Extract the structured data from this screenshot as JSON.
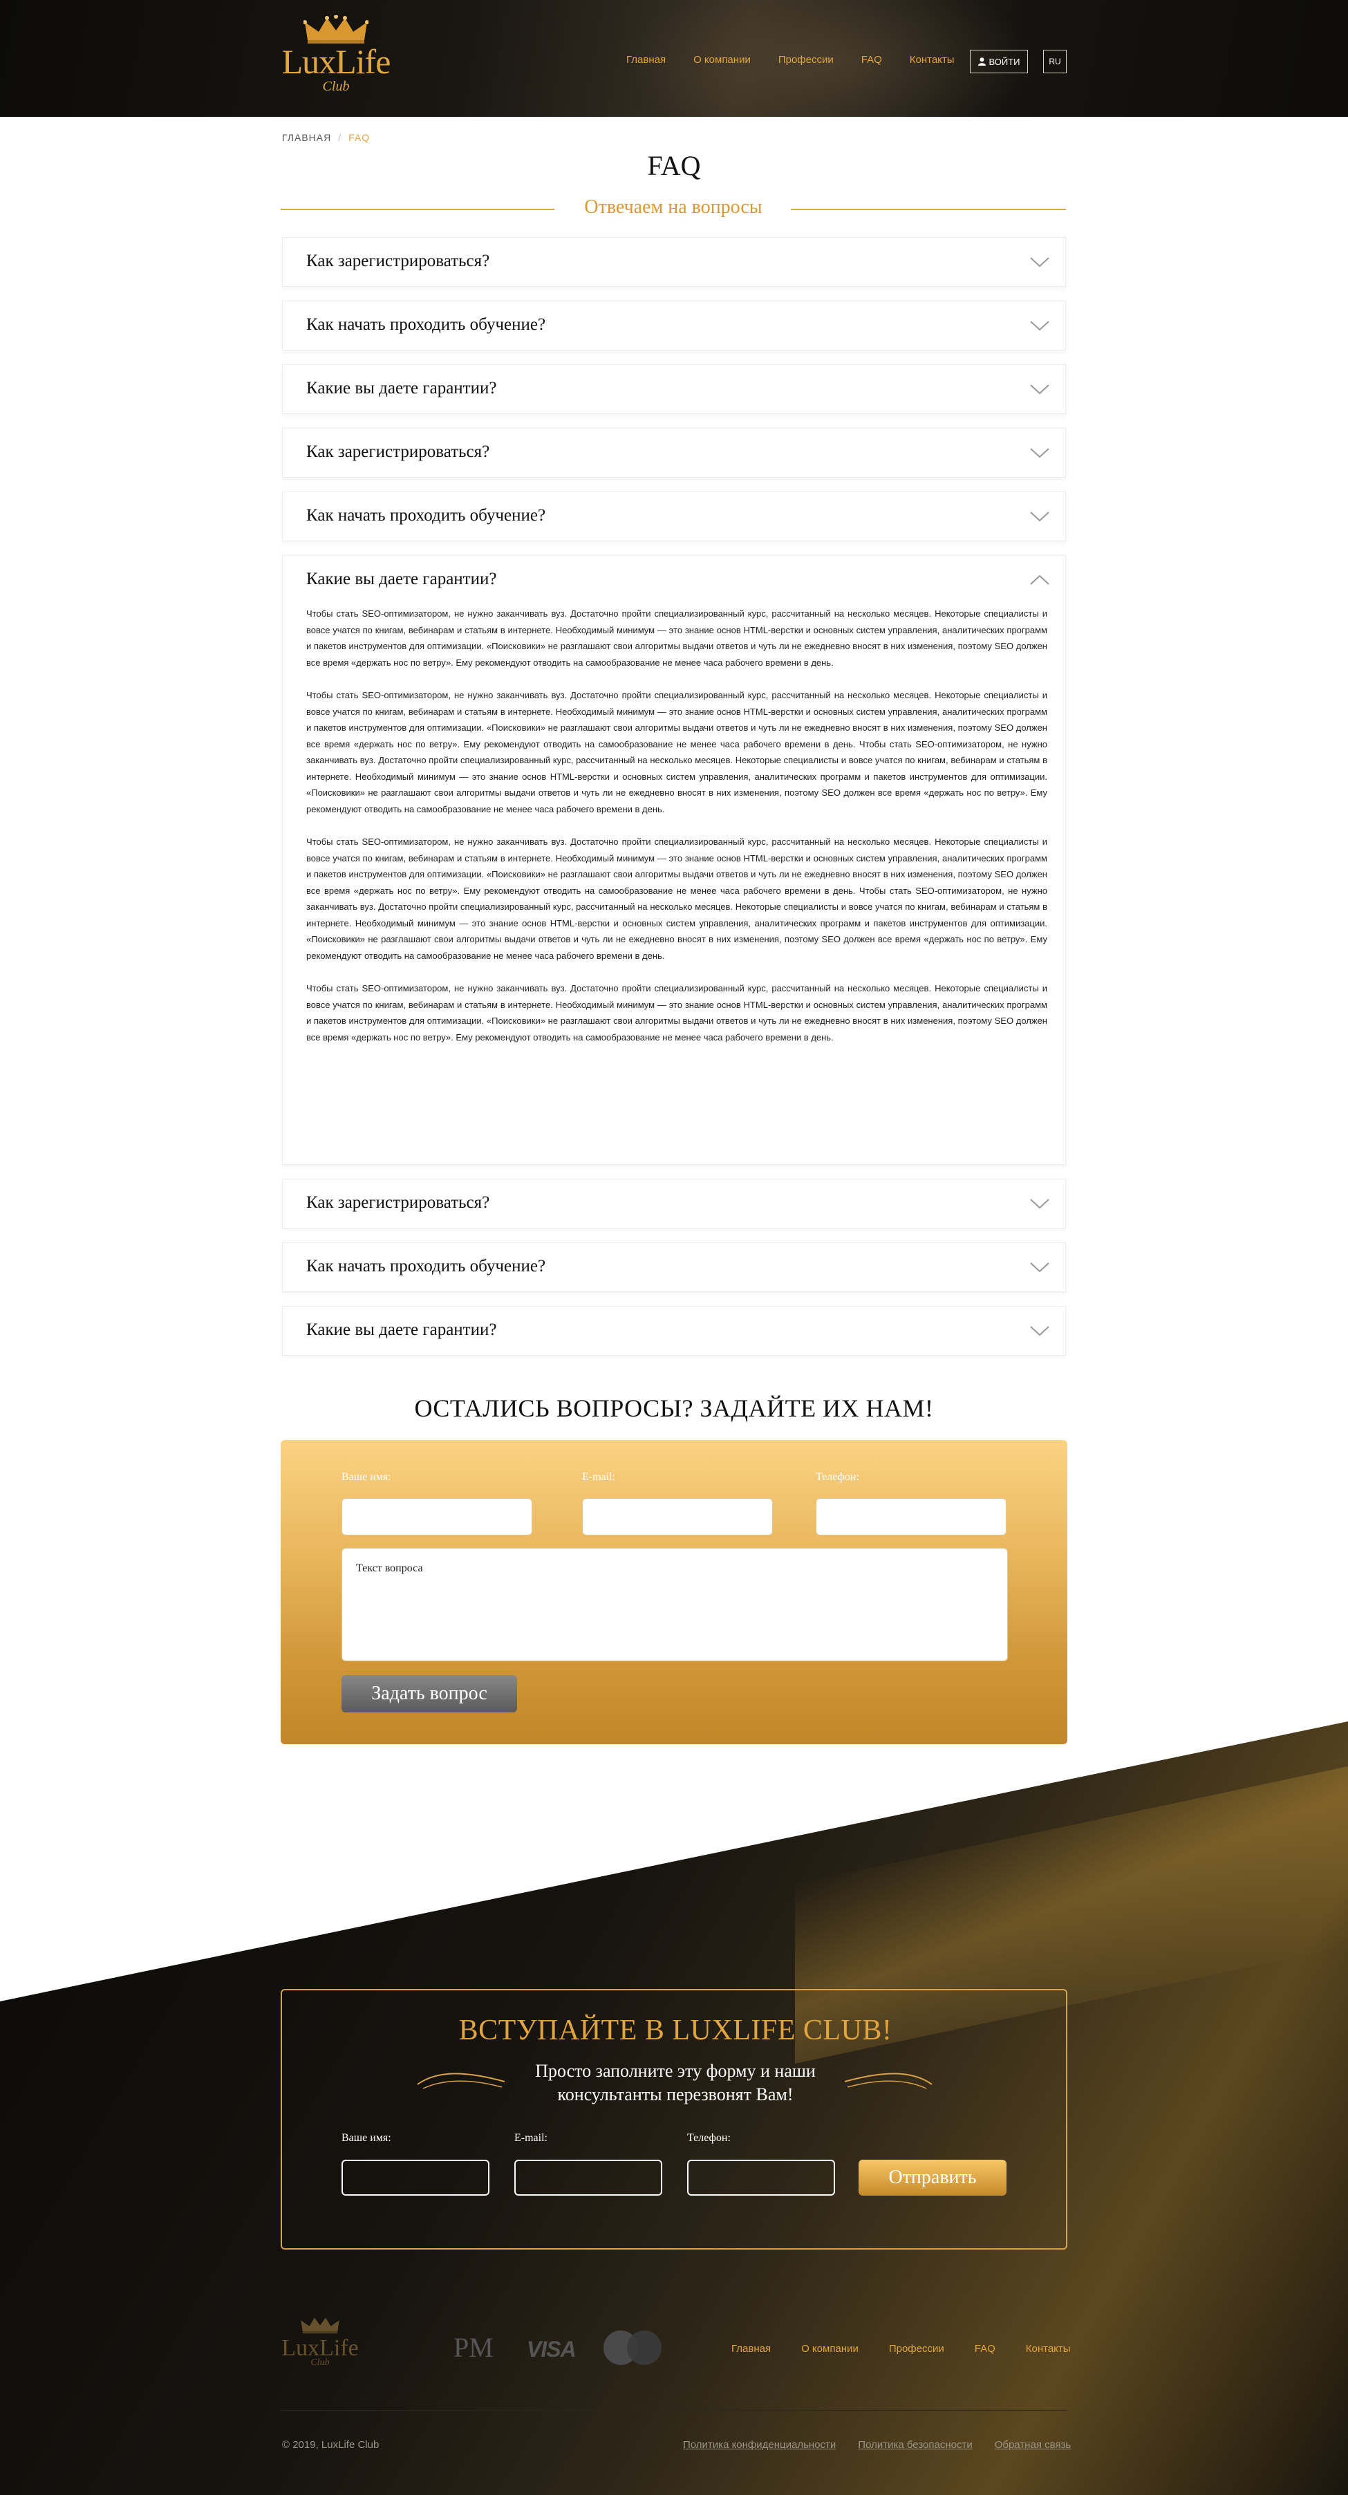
{
  "header": {
    "logo_text": "LuxLife",
    "logo_sub": "Club",
    "nav": [
      "Главная",
      "О компании",
      "Профессии",
      "FAQ",
      "Контакты"
    ],
    "login_label": "ВОЙТИ",
    "lang_label": "RU"
  },
  "breadcrumb": {
    "home": "ГЛАВНАЯ",
    "separator": "/",
    "current": "FAQ"
  },
  "page_title": "FAQ",
  "subtitle": "Отвечаем на вопросы",
  "faq": [
    {
      "question": "Как зарегистрироваться?"
    },
    {
      "question": "Как начать проходить обучение?"
    },
    {
      "question": "Какие вы даете гарантии?"
    },
    {
      "question": "Как зарегистрироваться?"
    },
    {
      "question": "Как начать проходить обучение?"
    },
    {
      "question": "Какие вы даете гарантии?",
      "open": true,
      "paragraphs": [
        "Чтобы стать SEO-оптимизатором, не нужно заканчивать вуз. Достаточно пройти специализированный курс, рассчитанный на несколько месяцев. Некоторые специалисты и вовсе учатся по книгам, вебинарам и статьям в интернете. Необходимый минимум — это знание основ HTML-верстки и основных систем управления, аналитических программ и пакетов инструментов для оптимизации. «Поисковики» не разглашают свои алгоритмы выдачи ответов и чуть ли не ежедневно вносят в них изменения, поэтому SEO должен все время «держать нос по ветру». Ему рекомендуют отводить на самообразование не менее часа рабочего времени в день.",
        "Чтобы стать SEO-оптимизатором, не нужно заканчивать вуз. Достаточно пройти специализированный курс, рассчитанный на несколько месяцев. Некоторые специалисты и вовсе учатся по книгам, вебинарам и статьям в интернете. Необходимый минимум — это знание основ HTML-верстки и основных систем управления, аналитических программ и пакетов инструментов для оптимизации. «Поисковики» не разглашают свои алгоритмы выдачи ответов и чуть ли не ежедневно вносят в них изменения, поэтому SEO должен все время «держать нос по ветру». Ему рекомендуют отводить на самообразование не менее часа рабочего времени в день. Чтобы стать SEO-оптимизатором, не нужно заканчивать вуз. Достаточно пройти специализированный курс, рассчитанный на несколько месяцев. Некоторые специалисты и вовсе учатся по книгам, вебинарам и статьям в интернете. Необходимый минимум — это знание основ HTML-верстки и основных систем управления, аналитических программ и пакетов инструментов для оптимизации. «Поисковики» не разглашают свои алгоритмы выдачи ответов и чуть ли не ежедневно вносят в них изменения, поэтому SEO должен все время «держать нос по ветру». Ему рекомендуют отводить на самообразование не менее часа рабочего времени в день.",
        "Чтобы стать SEO-оптимизатором, не нужно заканчивать вуз. Достаточно пройти специализированный курс, рассчитанный на несколько месяцев. Некоторые специалисты и вовсе учатся по книгам, вебинарам и статьям в интернете. Необходимый минимум — это знание основ HTML-верстки и основных систем управления, аналитических программ и пакетов инструментов для оптимизации. «Поисковики» не разглашают свои алгоритмы выдачи ответов и чуть ли не ежедневно вносят в них изменения, поэтому SEO должен все время «держать нос по ветру». Ему рекомендуют отводить на самообразование не менее часа рабочего времени в день. Чтобы стать SEO-оптимизатором, не нужно заканчивать вуз. Достаточно пройти специализированный курс, рассчитанный на несколько месяцев. Некоторые специалисты и вовсе учатся по книгам, вебинарам и статьям в интернете. Необходимый минимум — это знание основ HTML-верстки и основных систем управления, аналитических программ и пакетов инструментов для оптимизации. «Поисковики» не разглашают свои алгоритмы выдачи ответов и чуть ли не ежедневно вносят в них изменения, поэтому SEO должен все время «держать нос по ветру». Ему рекомендуют отводить на самообразование не менее часа рабочего времени в день.",
        "Чтобы стать SEO-оптимизатором, не нужно заканчивать вуз. Достаточно пройти специализированный курс, рассчитанный на несколько месяцев. Некоторые специалисты и вовсе учатся по книгам, вебинарам и статьям в интернете. Необходимый минимум — это знание основ HTML-верстки и основных систем управления, аналитических программ и пакетов инструментов для оптимизации. «Поисковики» не разглашают свои алгоритмы выдачи ответов и чуть ли не ежедневно вносят в них изменения, поэтому SEO должен все время «держать нос по ветру». Ему рекомендуют отводить на самообразование не менее часа рабочего времени в день."
      ]
    },
    {
      "question": "Как зарегистрироваться?"
    },
    {
      "question": "Как начать проходить обучение?"
    },
    {
      "question": "Какие вы даете гарантии?"
    }
  ],
  "question_form": {
    "title": "ОСТАЛИСЬ ВОПРОСЫ? ЗАДАЙТЕ ИХ НАМ!",
    "name_label": "Ваше имя:",
    "email_label": "E-mail:",
    "phone_label": "Телефон:",
    "textarea_placeholder": "Текст вопроса",
    "submit_label": "Задать вопрос"
  },
  "join_form": {
    "title": "ВСТУПАЙТЕ В LUXLIFE CLUB!",
    "subtitle_line1": "Просто заполните эту форму и наши",
    "subtitle_line2": "консультанты перезвонят Вам!",
    "name_label": "Ваше имя:",
    "email_label": "E-mail:",
    "phone_label": "Телефон:",
    "submit_label": "Отправить"
  },
  "footer": {
    "logo_text": "LuxLife",
    "logo_sub": "Club",
    "pm_label": "PM",
    "visa_label": "VISA",
    "nav": [
      "Главная",
      "О компании",
      "Профессии",
      "FAQ",
      "Контакты"
    ],
    "copyright": "© 2019, LuxLife Club",
    "links": [
      "Политика конфиденциальности",
      "Политика безопасности",
      "Обратная связь"
    ]
  },
  "colors": {
    "accent": "#e2a43c",
    "gold_light": "#fbd383",
    "gold_dark": "#c3862a",
    "dark": "#0c0b09"
  }
}
